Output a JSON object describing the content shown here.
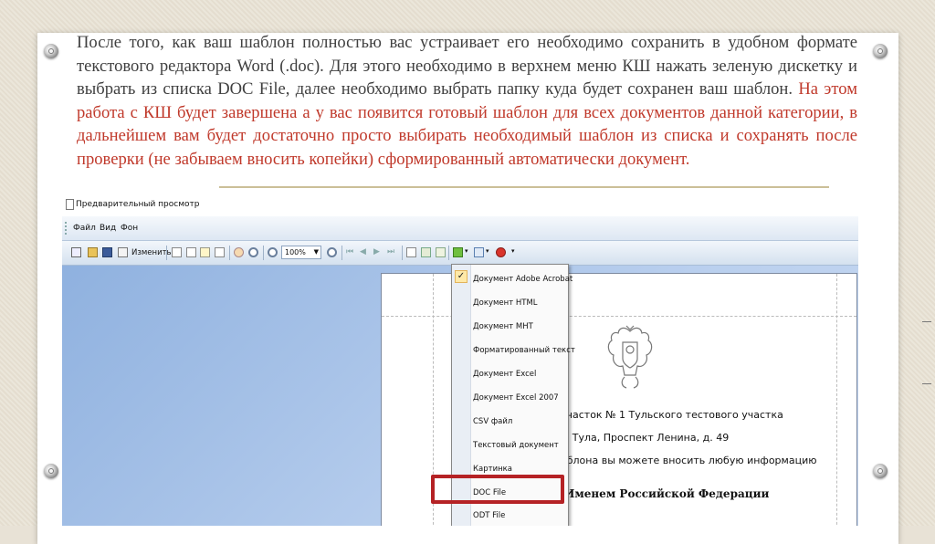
{
  "slide": {
    "paragraph_normal": "После того, как ваш шаблон полностью вас устраивает его необходимо сохранить в удобном формате текстового редактора Word (.doc). Для этого необходимо в верхнем меню КШ нажать зеленую дискетку и выбрать из списка DOC File, далее необходимо выбрать папку куда будет сохранен ваш шаблон.",
    "paragraph_red": "На этом работа с КШ будет завершена а у вас появится готовый шаблон для всех документов данной категории, в дальнейшем вам будет достаточно просто выбирать необходимый шаблон из списка и сохранять после проверки (не забываем вносить копейки) сформированный  автоматически документ."
  },
  "window": {
    "title": "Предварительный просмотр",
    "menu": [
      "Файл",
      "Вид",
      "Фон"
    ],
    "toolbar": {
      "edit_label": "Изменить",
      "zoom_value": "100%"
    }
  },
  "document": {
    "lines": [
      "участок № 1 Тульского тестового участка",
      "г. Тула, Проспект Ленина, д. 49",
      "аблона вы можете вносить любую информацию",
      "Именем Российской Федерации"
    ]
  },
  "export_menu": {
    "items": [
      "Документ Adobe Acrobat",
      "Документ HTML",
      "Документ MHT",
      "Форматированный текст",
      "Документ Excel",
      "Документ Excel 2007",
      "CSV файл",
      "Текстовый документ",
      "Картинка",
      "DOC File",
      "ODT File"
    ],
    "selected": "DOC File",
    "checked": "Документ Adobe Acrobat"
  },
  "colors": {
    "highlight": "#b52225",
    "red_text": "#c0392b"
  }
}
